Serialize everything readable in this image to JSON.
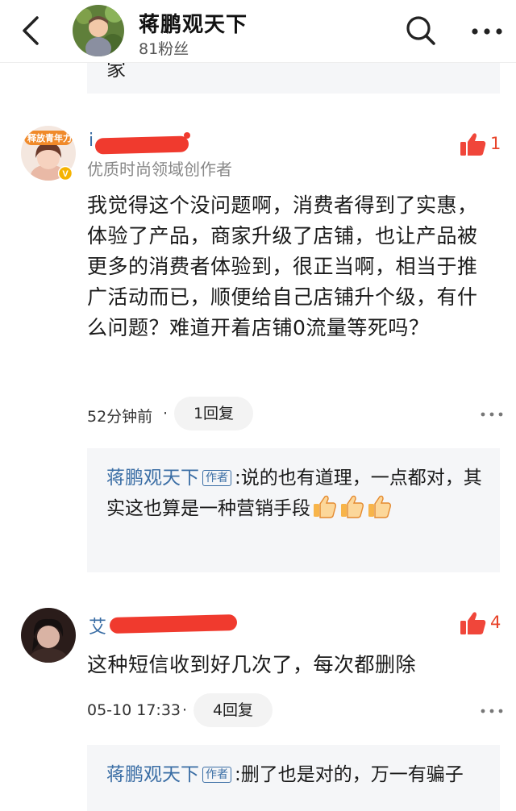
{
  "header": {
    "title": "蒋鹏观天下",
    "fans": "81粉丝"
  },
  "prev_reply": {
    "text": "家"
  },
  "comments": [
    {
      "username_visible": "i",
      "cert": "优质时尚领域创作者",
      "avatar_badge": "释放青年力",
      "likes": "1",
      "text": "我觉得这个没问题啊，消费者得到了实惠，体验了产品，商家升级了店铺，也让产品被更多的消费者体验到，很正当啊，相当于推广活动而已，顺便给自己店铺升个级，有什么问题？难道开着店铺0流量等死吗？",
      "time": "52分钟前",
      "sep": "·",
      "replies": "1回复",
      "sub_reply": {
        "name": "蒋鹏观天下",
        "tag": "作者",
        "text": "说的也有道理，一点都对，其实这也算是一种营销手段"
      }
    },
    {
      "username_visible": "艾",
      "likes": "4",
      "text": "这种短信收到好几次了，每次都删除",
      "time": "05-10 17:33",
      "sep": "·",
      "replies": "4回复",
      "sub_reply": {
        "name": "蒋鹏观天下",
        "tag": "作者",
        "text": "删了也是对的，万一有骗子"
      }
    }
  ],
  "colors": {
    "link": "#3b6ea5",
    "accent": "#e8442a",
    "reply_bg": "#f5f6f8"
  }
}
